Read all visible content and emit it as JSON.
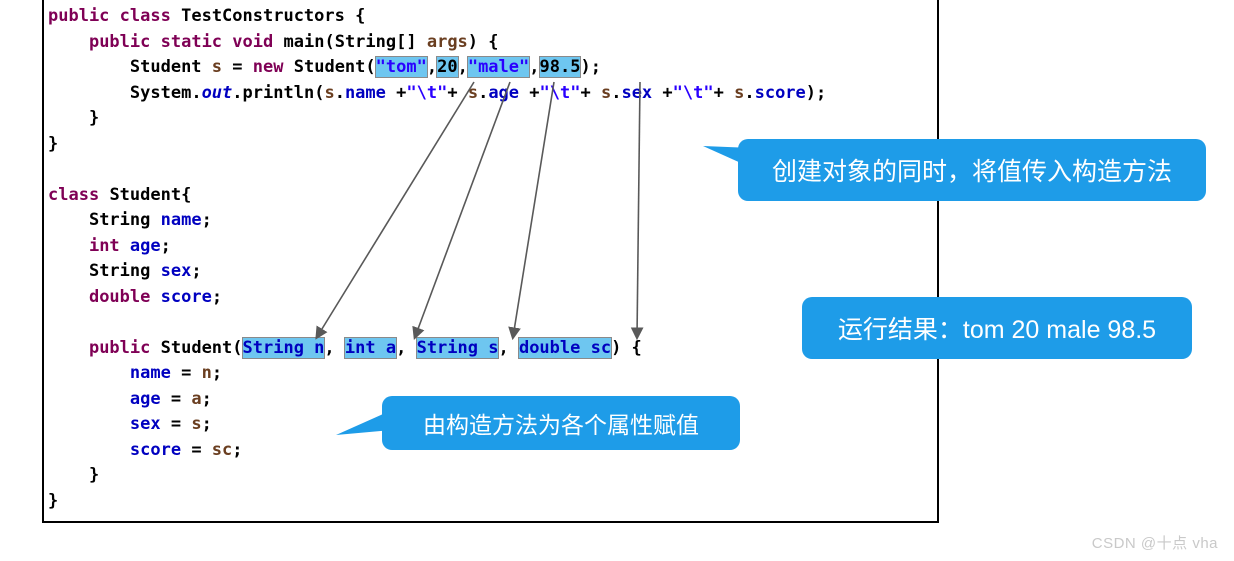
{
  "code": {
    "lines": [
      {
        "id": "line-class-decl",
        "text": "public class TestConstructors {"
      },
      {
        "id": "line-main-decl",
        "text": "    public static void main(String[] args) {"
      },
      {
        "id": "line-new-student",
        "text": "        Student s = new Student(\"tom\",20,\"male\",98.5);"
      },
      {
        "id": "line-println",
        "text": "        System.out.println(s.name +\"\\t\"+ s.age +\"\\t\"+ s.sex +\"\\t\"+ s.score);"
      },
      {
        "id": "line-close-main",
        "text": "    }"
      },
      {
        "id": "line-close-class",
        "text": "}"
      },
      {
        "id": "line-blank-1",
        "text": ""
      },
      {
        "id": "line-student-class",
        "text": "class Student{"
      },
      {
        "id": "line-field-name",
        "text": "    String name;"
      },
      {
        "id": "line-field-age",
        "text": "    int age;"
      },
      {
        "id": "line-field-sex",
        "text": "    String sex;"
      },
      {
        "id": "line-field-score",
        "text": "    double score;"
      },
      {
        "id": "line-blank-2",
        "text": ""
      },
      {
        "id": "line-constructor",
        "text": "    public Student(String n, int a, String s, double sc) {"
      },
      {
        "id": "line-assign-name",
        "text": "        name = n;"
      },
      {
        "id": "line-assign-age",
        "text": "        age = a;"
      },
      {
        "id": "line-assign-sex",
        "text": "        sex = s;"
      },
      {
        "id": "line-assign-score",
        "text": "        score = sc;"
      },
      {
        "id": "line-close-ctor",
        "text": "    }"
      },
      {
        "id": "line-close-student",
        "text": "}"
      }
    ],
    "tokens": {
      "kw_public": "public",
      "kw_class": "class",
      "kw_static": "static",
      "kw_void": "void",
      "kw_new": "new",
      "kw_int": "int",
      "kw_double": "double",
      "type_TestConstructors": "TestConstructors",
      "type_String": "String",
      "type_Student": "Student",
      "type_System": "System",
      "ident_main": "main",
      "ident_args": "args",
      "ident_out": "out",
      "ident_println": "println",
      "ident_s": "s",
      "ident_name": "name",
      "ident_age": "age",
      "ident_sex": "sex",
      "ident_score": "score",
      "ident_n": "n",
      "ident_a": "a",
      "ident_sc": "sc",
      "tab_escape": "\"\\t\""
    },
    "highlights": {
      "arg_name": "\"tom\"",
      "arg_age": "20",
      "arg_sex": "\"male\"",
      "arg_score": "98.5",
      "param_name": "String n",
      "param_age": "int a",
      "param_sex": "String s",
      "param_score": "double sc"
    },
    "colors": {
      "keyword": "#7f0055",
      "field": "#0000c0",
      "variable": "#6a3e20",
      "string": "#2a00ff",
      "highlight_fill": "#6ec6f0",
      "highlight_border": "#8a8a8a",
      "text": "#000000"
    }
  },
  "callouts": {
    "create": "创建对象的同时，将值传入构造方法",
    "result": "运行结果：tom  20  male  98.5",
    "assign": "由构造方法为各个属性赋值",
    "color": "#1e9ce8"
  },
  "arrows": {
    "count": 4,
    "color": "#595959",
    "description": "constructor argument to parameter mapping"
  },
  "watermark": "CSDN @十点 vha"
}
